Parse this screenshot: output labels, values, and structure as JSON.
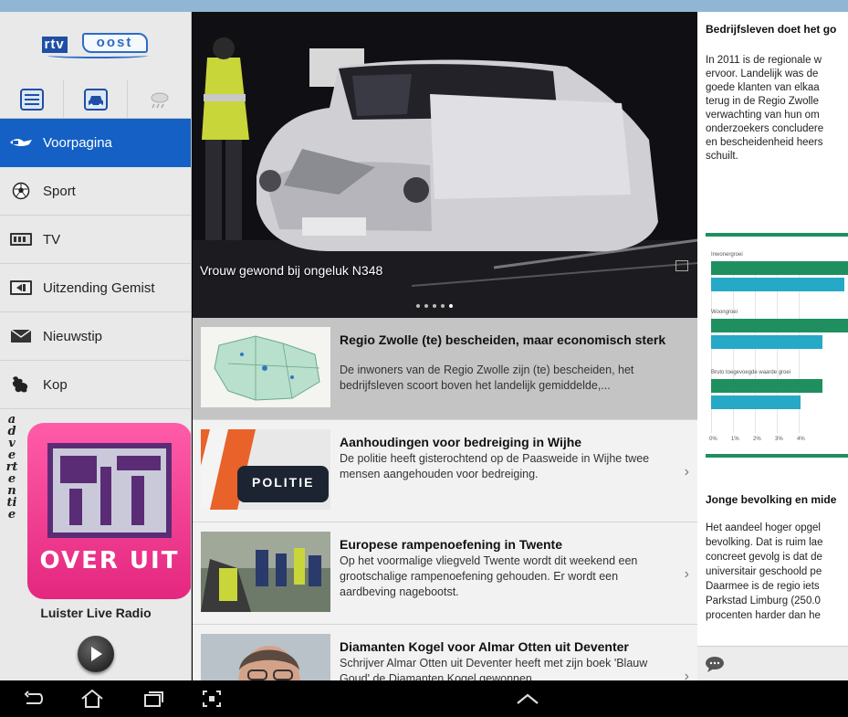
{
  "app": {
    "logo_rtv": "rtv",
    "logo_oost": "oost"
  },
  "sidebar": {
    "icon_tabs": [
      {
        "icon": "news-icon"
      },
      {
        "icon": "car-traffic-icon"
      },
      {
        "icon": "weather-icon"
      }
    ],
    "items": [
      {
        "label": "Voorpagina",
        "icon": "home-icon",
        "active": true
      },
      {
        "label": "Sport",
        "icon": "soccer-ball-icon"
      },
      {
        "label": "TV",
        "icon": "tv-icon"
      },
      {
        "label": "Uitzending Gemist",
        "icon": "replay-icon"
      },
      {
        "label": "Nieuwstip",
        "icon": "envelope-icon"
      },
      {
        "label": "Kop",
        "icon": "kop-icon"
      }
    ],
    "ad_vertical_text": "advertentie",
    "ad_text": "OVER UIT",
    "radio_label": "Luister Live Radio"
  },
  "hero": {
    "caption": "Vrouw gewond bij ongeluk N348",
    "slide_count": 5,
    "active_slide": 4
  },
  "articles": [
    {
      "title": "Regio Zwolle (te) bescheiden, maar economisch sterk",
      "description": "De inwoners van de Regio Zwolle zijn (te) bescheiden, het bedrijfsleven scoort boven het landelijk gemiddelde,...",
      "thumb": "map",
      "selected": true
    },
    {
      "title": "Aanhoudingen voor bedreiging in Wijhe",
      "description": "De politie heeft gisterochtend op de Paasweide in Wijhe twee mensen aangehouden voor bedreiging.",
      "thumb": "police",
      "thumb_text": "POLITIE"
    },
    {
      "title": "Europese rampenoefening in Twente",
      "description": "Op het voormalige vliegveld Twente wordt dit weekend een grootschalige rampenoefening gehouden. Er wordt een aardbeving nagebootst.",
      "thumb": "rescue"
    },
    {
      "title": "Diamanten Kogel voor Almar Otten uit Deventer",
      "description": "Schrijver Almar Otten uit Deventer heeft met zijn boek 'Blauw Goud' de Diamanten Kogel gewonnen.",
      "thumb": "portrait"
    }
  ],
  "detail": {
    "title": "Bedrijfsleven doet het go",
    "paragraph_lines": [
      "In 2011 is de regionale w",
      "ervoor. Landelijk was de",
      "goede klanten van elkaa",
      "terug in de Regio Zwolle",
      "verwachting van hun om",
      "onderzoekers concludere",
      "en bescheidenheid heers",
      "schuilt."
    ],
    "subtitle": "Jonge bevolking en mide",
    "paragraph2_lines": [
      "Het aandeel hoger opgel",
      "bevolking. Dat is ruim lae",
      "concreet gevolg is dat de",
      "universitair geschoold pe",
      "Daarmee is de regio iets",
      "Parkstad Limburg (250.0",
      "procenten harder dan he"
    ]
  },
  "chart_data": {
    "type": "bar",
    "orientation": "horizontal",
    "categories": [
      "Inwonergroei",
      "Woongroei",
      "Bruto toegevoegde waarde groei"
    ],
    "series": [
      {
        "color": "#1f8f5f",
        "values": [
          6.5,
          6.9,
          5.1
        ]
      },
      {
        "color": "#26a9c6",
        "values": [
          6.1,
          5.1,
          4.1
        ]
      }
    ],
    "x_ticks": [
      "0%",
      "1%",
      "2%",
      "3%",
      "4%"
    ],
    "xlim": [
      0,
      7
    ]
  },
  "colors": {
    "accent_blue": "#1460c4",
    "ad_pink": "#e4277f",
    "status_bar": "#8fb7d3"
  },
  "navbar": {
    "buttons": [
      "back-icon",
      "home-icon",
      "recent-apps-icon",
      "screenshot-icon",
      "chevron-up-icon"
    ]
  }
}
